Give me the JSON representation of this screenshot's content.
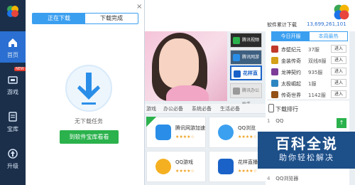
{
  "sidebar": {
    "items": [
      {
        "label": "首页",
        "icon": "home-icon"
      },
      {
        "label": "游戏",
        "icon": "game-icon",
        "badge": "NEW"
      },
      {
        "label": "宝库",
        "icon": "store-icon"
      },
      {
        "label": "升级",
        "icon": "upgrade-icon"
      }
    ]
  },
  "download_panel": {
    "tabs": [
      "正在下载",
      "下载完成"
    ],
    "active_tab": 0,
    "empty_text": "无下载任务",
    "browse_button": "到软件宝库看看",
    "close_glyph": "×"
  },
  "banner": {
    "thumbs": [
      {
        "label": "腾讯视频"
      },
      {
        "label": "腾讯网游加速器"
      },
      {
        "label": "花样直播"
      },
      {
        "label": "腾讯办公助手"
      }
    ]
  },
  "categories": [
    "游戏",
    "办公必备",
    "系统必备",
    "生活必备"
  ],
  "apps": [
    {
      "name": "腾讯网游加速",
      "stars": "★★★★☆",
      "color": "#2a8ee8",
      "is_new": true
    },
    {
      "name": "QQ浏览",
      "stars": "★★★★☆",
      "color": "#3ba0f0",
      "is_new": false
    },
    {
      "name": "QQ游戏",
      "stars": "★★★★☆",
      "color": "#f5b021",
      "is_new": false
    },
    {
      "name": "花样直播",
      "stars": "★★★★☆",
      "color": "#1a62c8",
      "is_new": false
    }
  ],
  "ranking": {
    "total_label": "软件累计下载",
    "total_value": "13,699,261,101",
    "tabs": [
      "今日开服",
      "本周最热"
    ],
    "active_tab": 0,
    "rows": [
      {
        "name": "赤壁纪元",
        "count": "37服",
        "action": "进入",
        "color": "#c0392b"
      },
      {
        "name": "金装传奇",
        "count": "双线8服",
        "action": "进入",
        "color": "#d4a017"
      },
      {
        "name": "龙神契约",
        "count": "935服",
        "action": "进入",
        "color": "#7d3c98"
      },
      {
        "name": "太极崛起",
        "count": "1服",
        "action": "进入",
        "color": "#2e86c1"
      },
      {
        "name": "传奇世界",
        "count": "1142服",
        "action": "进入",
        "color": "#935116"
      }
    ],
    "download_rank_title": "下载排行",
    "download_rank_items": [
      {
        "num": "1",
        "name": "QQ"
      },
      {
        "num": "4",
        "name": "QQ浏览器"
      }
    ],
    "scroll_up": "↑"
  },
  "watermark": {
    "title": "百科全说",
    "subtitle": "助你轻松解决"
  },
  "colors": {
    "sidebar_bg": "#1b2f4a",
    "accent_blue": "#3b9ff0",
    "accent_green": "#2bb24c"
  }
}
